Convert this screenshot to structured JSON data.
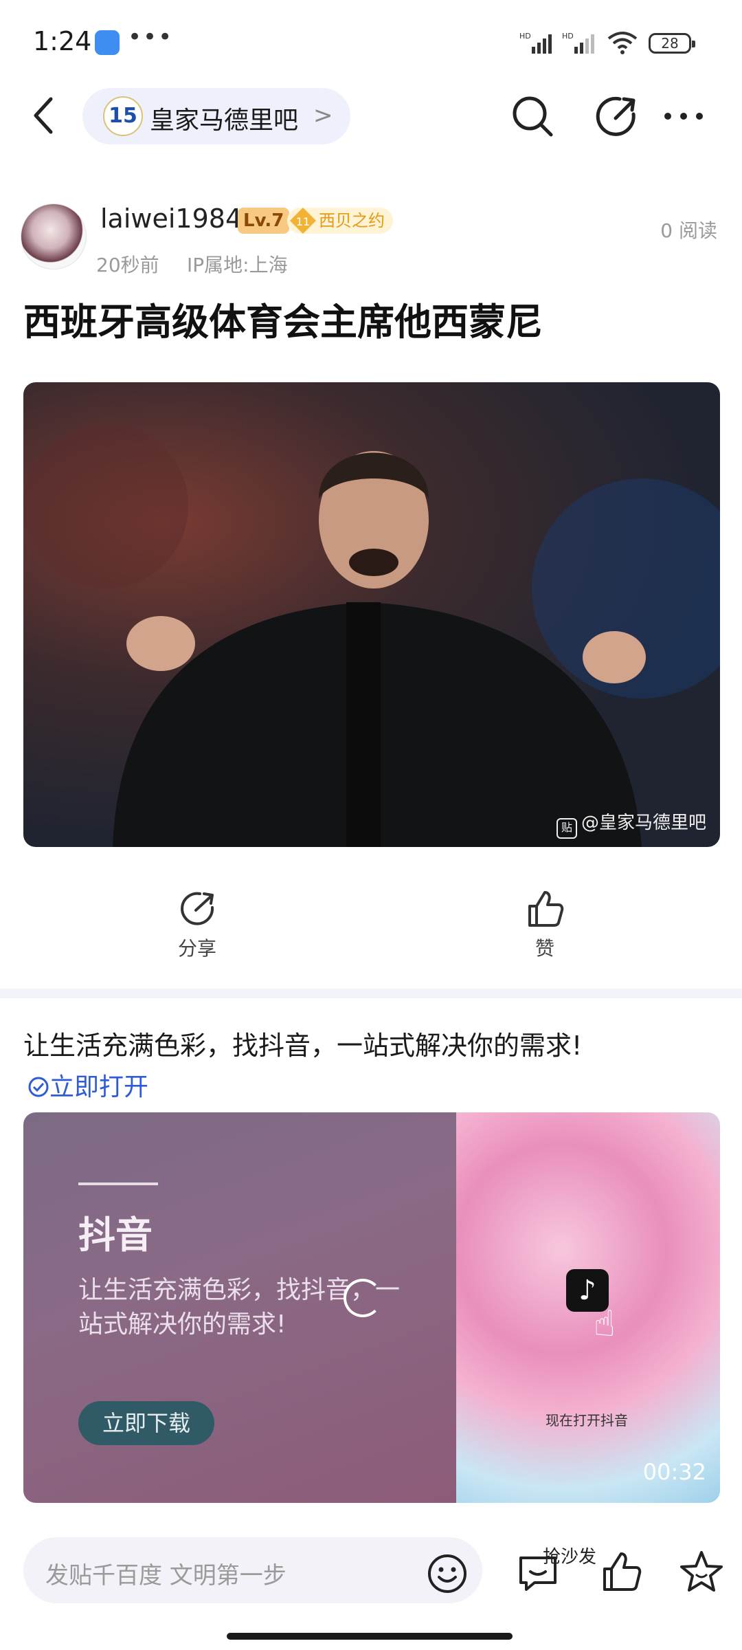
{
  "status_bar": {
    "time": "1:24",
    "dots": "•••",
    "signal_label_1": "HD",
    "signal_label_2": "HD",
    "battery": "28"
  },
  "nav": {
    "forum_badge": "15",
    "forum_name": "皇家马德里吧",
    "chevron": ">"
  },
  "author": {
    "username": "laiwei1984",
    "level": "Lv.7",
    "fan_level": "11",
    "fan_badge": "西贝之约",
    "read_count": "0 阅读",
    "time_ago": "20秒前",
    "ip_location": "IP属地:上海"
  },
  "post": {
    "title": "西班牙高级体育会主席他西蒙尼",
    "image_watermark": "@皇家马德里吧",
    "watermark_icon": "贴"
  },
  "actions": {
    "share_label": "分享",
    "like_label": "赞"
  },
  "ad": {
    "text": "让生活充满色彩，找抖音，一站式解决你的需求!",
    "open_link": "立即打开",
    "card_title": "抖音",
    "card_desc": "让生活充满色彩，找抖音，一站式解决你的需求!",
    "download_button": "立即下载",
    "app_icon_glyph": "♪",
    "open_caption": "现在打开抖音",
    "duration": "00:32"
  },
  "bottom_bar": {
    "input_placeholder": "发贴千百度 文明第一步",
    "sofa_label": "抢沙发"
  }
}
